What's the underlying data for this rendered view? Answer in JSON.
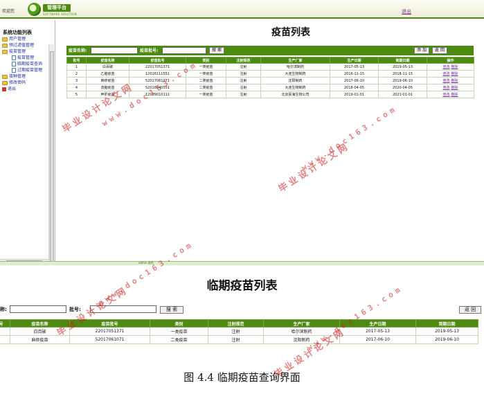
{
  "shot1": {
    "header": {
      "welcome": "欢迎您",
      "logo_text": "管理平台",
      "logo_sub": "SOFTWARE SOLUTION",
      "logout": "退出"
    },
    "sidebar": {
      "title": "系统功能列表",
      "items": [
        {
          "label": "用户管理",
          "icon": "folder-icon"
        },
        {
          "label": "预过滤值管理",
          "icon": "folder-icon"
        },
        {
          "label": "疫苗管理",
          "icon": "folder-open-icon"
        },
        {
          "label": "疫苗管理",
          "icon": "document-icon"
        },
        {
          "label": "临期疫苗查询",
          "icon": "document-icon"
        },
        {
          "label": "过期疫苗管理",
          "icon": "document-icon"
        },
        {
          "label": "接种管理",
          "icon": "folder-icon"
        },
        {
          "label": "修改密码",
          "icon": "folder-icon"
        },
        {
          "label": "退出",
          "icon": "exit-icon"
        }
      ]
    },
    "main": {
      "title": "疫苗列表",
      "search": {
        "name_label": "疫苗名称:",
        "batch_label": "疫苗批号:",
        "search_button": "搜 索",
        "add_button": "添 加",
        "back_button": "返 回"
      },
      "columns": [
        "批号",
        "疫苗名称",
        "疫苗批号",
        "类别",
        "注射规范",
        "生产厂家",
        "生产日期",
        "到期日期",
        "操作"
      ],
      "rows": [
        {
          "no": "1",
          "name": "白百破",
          "batch": "22017051371",
          "type": "一类疫苗",
          "inject": "注射",
          "maker": "哈尔滨制药",
          "prod": "2017-05-13",
          "expire": "2019-05-13"
        },
        {
          "no": "2",
          "name": "乙脑疫苗",
          "batch": "12016111551",
          "type": "一类疫苗",
          "inject": "注射",
          "maker": "大连生物制药",
          "prod": "2016-11-15",
          "expire": "2018-11-15"
        },
        {
          "no": "3",
          "name": "麻疹疫苗",
          "batch": "52017061071",
          "type": "二类疫苗",
          "inject": "注射",
          "maker": "沈阳制药",
          "prod": "2017-06-10",
          "expire": "2019-06-10"
        },
        {
          "no": "4",
          "name": "流脑疫苗",
          "batch": "52018040551",
          "type": "二类疫苗",
          "inject": "注射",
          "maker": "大连生物制药",
          "prod": "2018-04-05",
          "expire": "2020-04-05"
        },
        {
          "no": "5",
          "name": "甲肝疫苗",
          "batch": "12019010111",
          "type": "一类疫苗",
          "inject": "注射",
          "maker": "北京民海生物公司",
          "prod": "2019-01-01",
          "expire": "2021-01-01"
        }
      ],
      "op_edit": "修改",
      "op_delete": "删除"
    },
    "status": "admin 角色"
  },
  "shot2": {
    "title": "临期疫苗列表",
    "search": {
      "name_label": "称:",
      "batch_label": "批号:",
      "search_button": "搜 索",
      "back_button": "返 回"
    },
    "columns": [
      "号",
      "疫苗名称",
      "疫苗批号",
      "类别",
      "注射规范",
      "生产厂家",
      "生产日期",
      "到期日期"
    ],
    "rows": [
      {
        "no": "",
        "name": "白百破",
        "batch": "22017051371",
        "type": "一类疫苗",
        "inject": "注射",
        "maker": "哈尔滨制药",
        "prod": "2017-05-13",
        "expire": "2019-05-13"
      },
      {
        "no": "",
        "name": "麻疹疫苗",
        "batch": "52017061071",
        "type": "二类疫苗",
        "inject": "注射",
        "maker": "沈阳制药",
        "prod": "2017-06-10",
        "expire": "2019-06-10"
      }
    ]
  },
  "caption": "图 4.4  临期疫苗查询界面",
  "watermark": {
    "cn": "毕业设计论文网",
    "url": "www.doc163.com"
  },
  "colors": {
    "brand_green": "#4d8a12",
    "link_purple": "#6d2a93",
    "watermark_red": "#c81e1e"
  }
}
